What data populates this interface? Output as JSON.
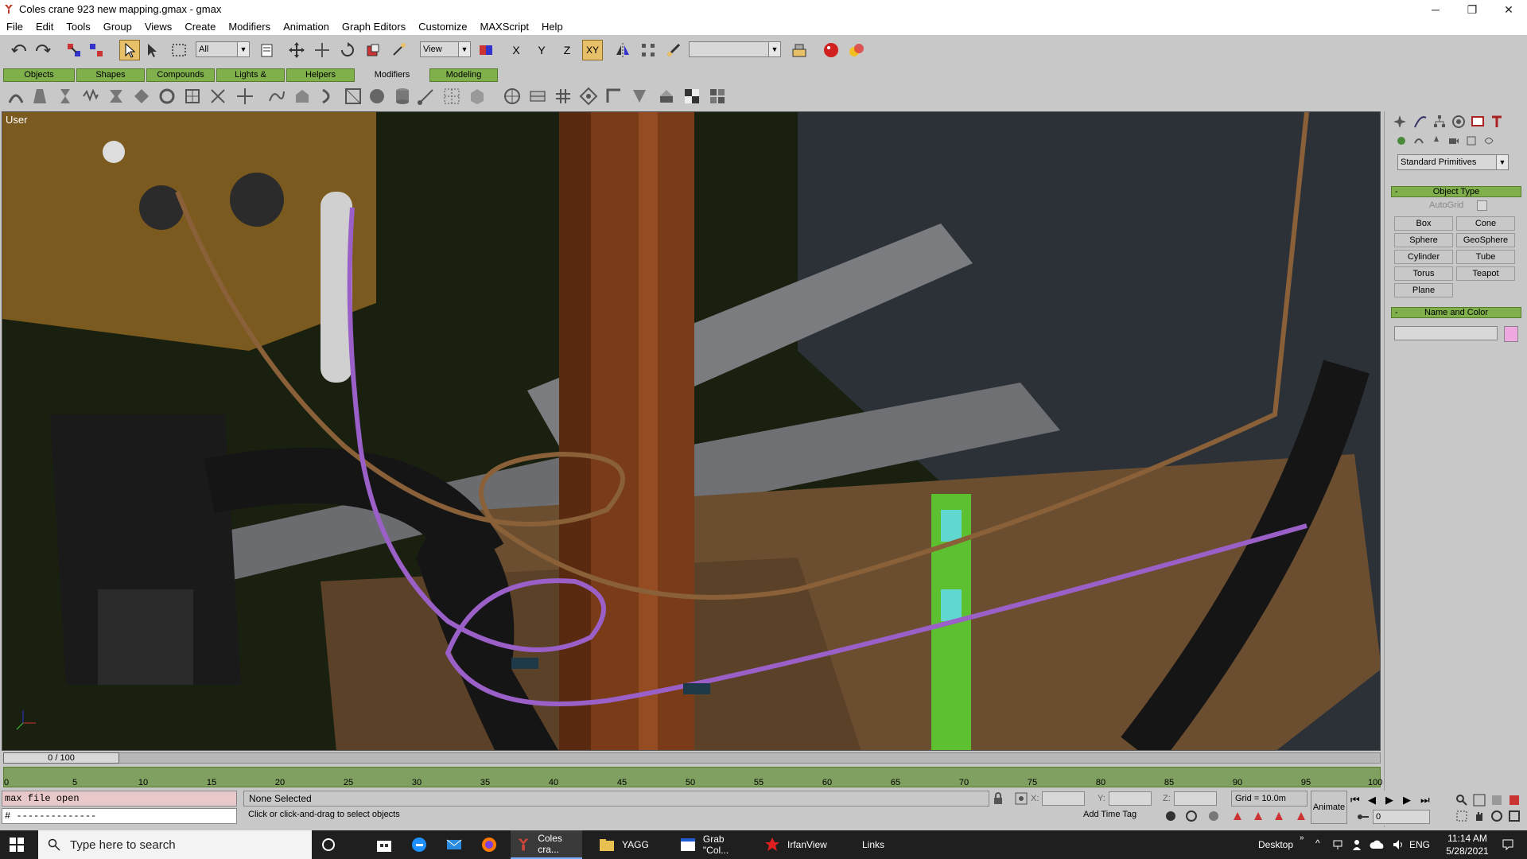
{
  "window": {
    "title": "Coles crane 923 new mapping.gmax - gmax",
    "min": "─",
    "max": "❐",
    "close": "✕"
  },
  "menu": [
    "File",
    "Edit",
    "Tools",
    "Group",
    "Views",
    "Create",
    "Modifiers",
    "Animation",
    "Graph Editors",
    "Customize",
    "MAXScript",
    "Help"
  ],
  "toolbar": {
    "selection_filter": "All",
    "ref_coord": "View",
    "named_sets": "",
    "x": "X",
    "y": "Y",
    "z": "Z",
    "xy": "XY"
  },
  "tabs": [
    "Objects",
    "Shapes",
    "Compounds",
    "Lights & Cameras",
    "Helpers",
    "Modifiers",
    "Modeling"
  ],
  "viewport": {
    "label": "User"
  },
  "command_panel": {
    "category": "Standard Primitives",
    "object_type": {
      "title": "Object Type",
      "autogrid": "AutoGrid",
      "buttons": [
        "Box",
        "Cone",
        "Sphere",
        "GeoSphere",
        "Cylinder",
        "Tube",
        "Torus",
        "Teapot",
        "Plane"
      ]
    },
    "name_color": {
      "title": "Name and Color",
      "name_value": "",
      "swatch_color": "#f0a8e0"
    }
  },
  "timeline": {
    "slider": "0 / 100",
    "ticks": [
      "0",
      "5",
      "10",
      "15",
      "20",
      "25",
      "30",
      "35",
      "40",
      "45",
      "50",
      "55",
      "60",
      "65",
      "70",
      "75",
      "80",
      "85",
      "90",
      "95",
      "100"
    ]
  },
  "status": {
    "maxscript_line1": "max file open",
    "maxscript_line2": "# --------------",
    "selection": "None Selected",
    "prompt": "Click or click-and-drag to select objects",
    "x_label": "X:",
    "y_label": "Y:",
    "z_label": "Z:",
    "x_val": "",
    "y_val": "",
    "z_val": "",
    "grid": "Grid = 10.0m",
    "add_time_tag": "Add Time Tag",
    "animate": "Animate",
    "frame": "0"
  },
  "taskbar": {
    "search_placeholder": "Type here to search",
    "tasks": [
      "Coles cra...",
      "YAGG",
      "Grab \"Col...",
      "IrfanView"
    ],
    "links": "Links",
    "desktop": "Desktop",
    "lang": "ENG",
    "time": "11:14 AM",
    "date": "5/28/2021"
  }
}
